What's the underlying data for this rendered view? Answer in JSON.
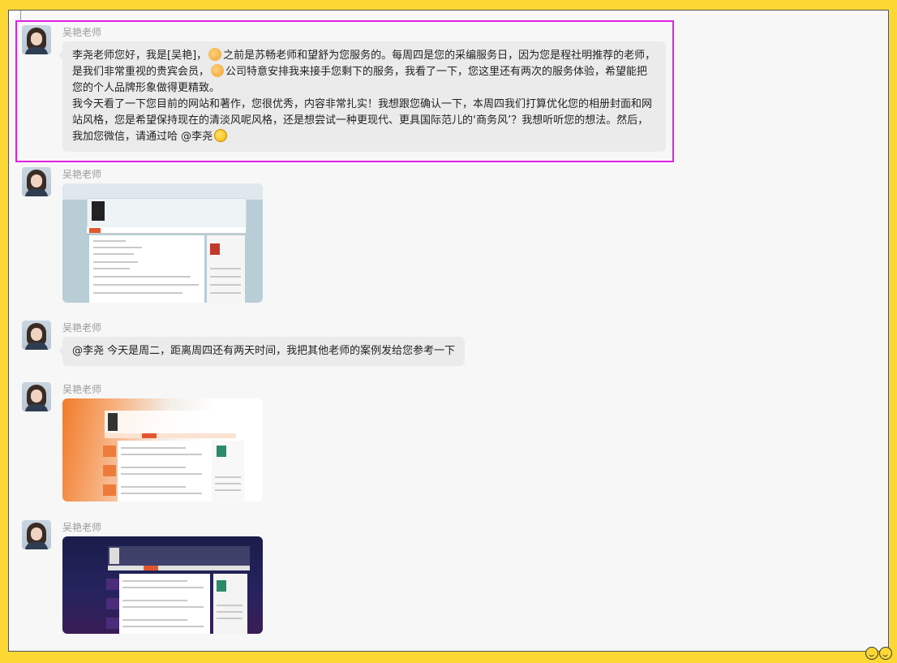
{
  "messages": [
    {
      "sender": "吴艳老师",
      "type": "text",
      "paragraphs": [
        [
          "李尧老师您好，我是[吴艳]，",
          "之前是苏畅老师和望舒为您服务的。每周四是您的采编服务日，因为您是程社明推荐的老师，是我们非常重视的贵宾会员，",
          "公司特意安排我来接手您剩下的服务，我看了一下，您这里还有两次的服务体验，希望能把您的个人品牌形象做得更精致。"
        ],
        [
          "我今天看了一下您目前的网站和著作，您很优秀，内容非常扎实！我想跟您确认一下，本周四我们打算优化您的相册封面和网站风格，您是希望保持现在的清淡风呢风格，还是想尝试一种更现代、更具国际范儿的‘商务风’？我想听听您的想法。然后，我加您微信，请通过哈 @李尧"
        ]
      ],
      "emojis": [
        "handshake-emoji",
        "handshake-emoji",
        "grin-emoji"
      ]
    },
    {
      "sender": "吴艳老师",
      "type": "image",
      "image": "screenshot-website-light-blue"
    },
    {
      "sender": "吴艳老师",
      "type": "text",
      "text": "@李尧   今天是周二，距离周四还有两天时间，我把其他老师的案例发给您参考一下"
    },
    {
      "sender": "吴艳老师",
      "type": "image",
      "image": "screenshot-website-orange"
    },
    {
      "sender": "吴艳老师",
      "type": "image",
      "image": "screenshot-website-purple"
    }
  ],
  "colors": {
    "window_bg": "#fdd835",
    "chat_bg": "#f7f7f8",
    "bubble": "#ebebeb",
    "highlight": "#e020e0",
    "accent": "#e4572e"
  },
  "icons": [
    "avatar",
    "handshake-emoji",
    "grin-emoji",
    "emoji-panel-icon"
  ]
}
